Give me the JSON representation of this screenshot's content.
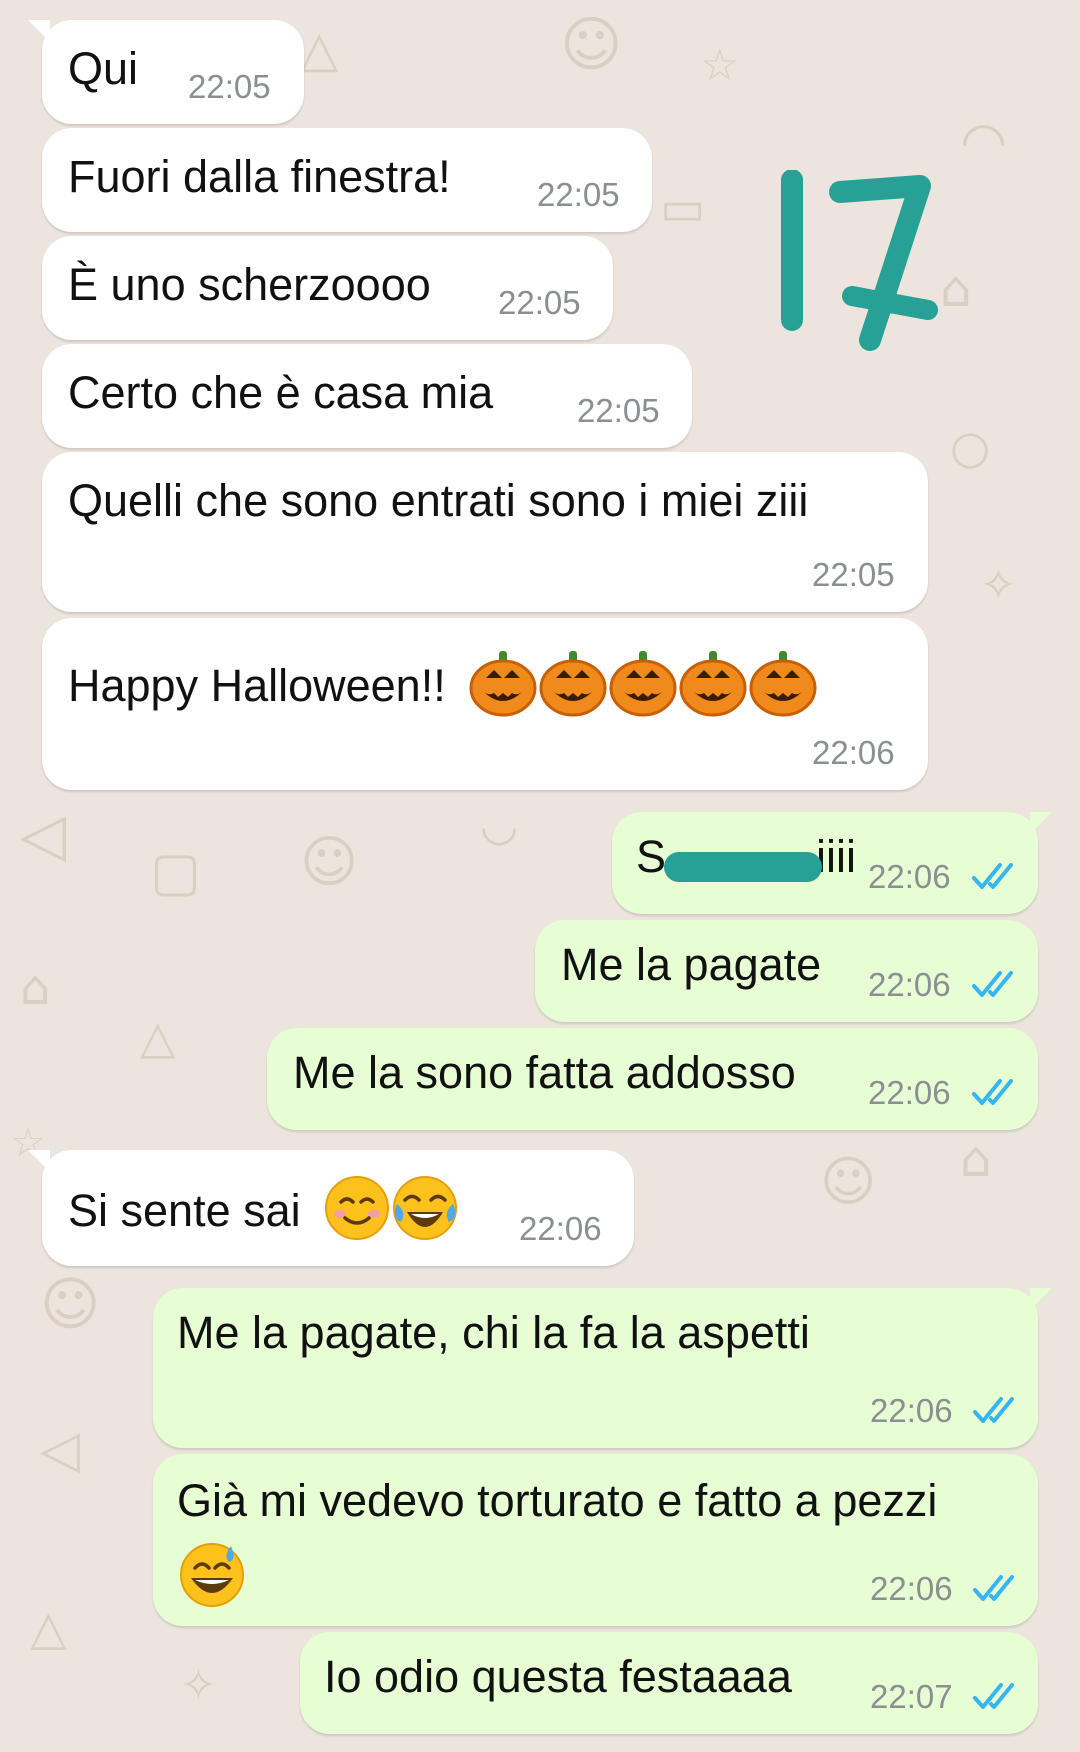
{
  "theme": {
    "incoming_bg": "#ffffff",
    "outgoing_bg": "#e7fed5",
    "wallpaper_bg": "#ece5dd",
    "tick_color": "#34b7f1",
    "annotation_color": "#27a195"
  },
  "annotation": {
    "text": "17",
    "icon": "hand-drawn-number-17"
  },
  "messages": [
    {
      "dir": "in",
      "text": "Qui",
      "time": "22:05"
    },
    {
      "dir": "in",
      "text": "Fuori dalla finestra!",
      "time": "22:05"
    },
    {
      "dir": "in",
      "text": "È uno scherzoooo",
      "time": "22:05"
    },
    {
      "dir": "in",
      "text": "Certo che è casa mia",
      "time": "22:05"
    },
    {
      "dir": "in",
      "text": "Quelli che sono entrati sono i miei ziii",
      "time": "22:05"
    },
    {
      "dir": "in",
      "text": "Happy Halloween!!",
      "emojis": [
        "jack-o-lantern",
        "jack-o-lantern",
        "jack-o-lantern",
        "jack-o-lantern",
        "jack-o-lantern"
      ],
      "time": "22:06"
    },
    {
      "dir": "out",
      "text_start": "S",
      "text_end": "iiii",
      "censored": true,
      "time": "22:06",
      "status": "read"
    },
    {
      "dir": "out",
      "text": "Me la pagate",
      "time": "22:06",
      "status": "read"
    },
    {
      "dir": "out",
      "text": "Me la sono fatta addosso",
      "time": "22:06",
      "status": "read"
    },
    {
      "dir": "in",
      "text": "Si sente sai",
      "emojis": [
        "smiling-face-with-smiling-eyes",
        "face-with-tears-of-joy"
      ],
      "time": "22:06"
    },
    {
      "dir": "out",
      "text": "Me la pagate, chi la fa la aspetti",
      "time": "22:06",
      "status": "read"
    },
    {
      "dir": "out",
      "text": "Già mi vedevo torturato e fatto a pezzi",
      "emojis": [
        "grinning-face-with-sweat"
      ],
      "time": "22:06",
      "status": "read"
    },
    {
      "dir": "out",
      "text": "Io odio questa festaaaa",
      "time": "22:07",
      "status": "read"
    }
  ]
}
